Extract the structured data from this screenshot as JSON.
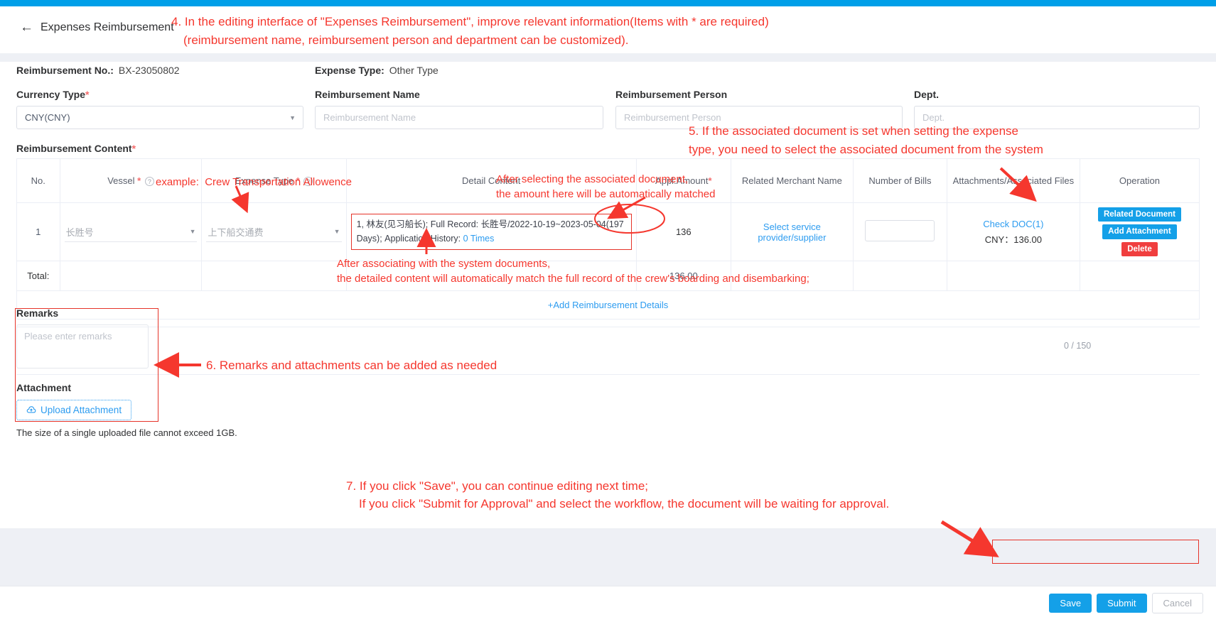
{
  "header": {
    "back_label": "Expenses Reimbursement",
    "back_icon": "arrow-left-icon"
  },
  "meta": {
    "no_label": "Reimbursement No.:",
    "no_value": "BX-23050802",
    "type_label": "Expense Type:",
    "type_value": "Other Type"
  },
  "fields": [
    {
      "label": "Currency Type",
      "required": true,
      "value": "CNY(CNY)",
      "placeholder": "",
      "select": true
    },
    {
      "label": "Reimbursement Name",
      "required": false,
      "value": "",
      "placeholder": "Reimbursement Name",
      "select": false
    },
    {
      "label": "Reimbursement Person",
      "required": false,
      "value": "",
      "placeholder": "Reimbursement Person",
      "select": false
    },
    {
      "label": "Dept.",
      "required": false,
      "value": "",
      "placeholder": "Dept.",
      "select": false
    }
  ],
  "content_section": {
    "label": "Reimbursement Content",
    "required": true
  },
  "table": {
    "headers": {
      "no": "No.",
      "vessel": "Vessel",
      "expense_type": "Expense Type",
      "detail": "Detail Content",
      "amount": "Appl.Amount",
      "merchant": "Related Merchant Name",
      "bills": "Number of Bills",
      "attachments": "Attachments/Associated Files",
      "operation": "Operation"
    },
    "row": {
      "no": "1",
      "vessel": "长胜号",
      "expense_type": "上下船交通费",
      "detail_prefix": "1, 林友(见习船长);  Full Record: 长胜号/2022-10-19~2023-05-04(197 Days);  Application History: ",
      "detail_link": "0 Times",
      "amount": "136",
      "merchant_link_line1": "Select service",
      "merchant_link_line2": "provider/supplier",
      "bills": "",
      "attachment_link": "Check DOC(1)",
      "attachment_amount": "CNY：136.00",
      "ops": [
        {
          "label": "Related Document",
          "style": "blue"
        },
        {
          "label": "Add Attachment",
          "style": "blue"
        },
        {
          "label": "Delete",
          "style": "red"
        }
      ]
    },
    "total": {
      "label": "Total:",
      "amount": "136.00"
    },
    "add_row_link": "+Add Reimbursement Details"
  },
  "remarks": {
    "title": "Remarks",
    "placeholder": "Please enter remarks",
    "counter": "0 / 150"
  },
  "attachment": {
    "title": "Attachment",
    "upload_label": "Upload Attachment",
    "upload_icon": "cloud-upload-icon",
    "hint": "The size of a single uploaded file cannot exceed 1GB."
  },
  "footer": {
    "save": "Save",
    "submit": "Submit",
    "cancel": "Cancel"
  },
  "annotations": {
    "a4_line1": "4. In the editing interface of \"Expenses Reimbursement\", improve relevant information(Items with * are required)",
    "a4_line2": "(reimbursement name, reimbursement person and department can be customized).",
    "example": "example:  Crew Transportation Allowence",
    "a5_line1": "5. If the associated document is set when setting the expense",
    "a5_line2": "type, you need to select the associated document from the system",
    "amount_note_line1": "After selecting the associated document,",
    "amount_note_line2": "the amount here will be automatically matched",
    "detail_note_line1": "After associating with the system documents,",
    "detail_note_line2": "the detailed content will automatically match the full record of the crew's boarding and disembarking;",
    "a6": "6. Remarks and attachments can be added as needed",
    "a7_line1": "7. If you click \"Save\", you can continue editing next time;",
    "a7_line2": "If you click \"Submit for Approval\" and select the workflow, the document will be waiting for approval."
  },
  "colors": {
    "accent": "#14a0e8",
    "annotation": "#f5372e",
    "danger": "#f03e3e",
    "link": "#2d9cf0",
    "topbar": "#009fe8"
  }
}
